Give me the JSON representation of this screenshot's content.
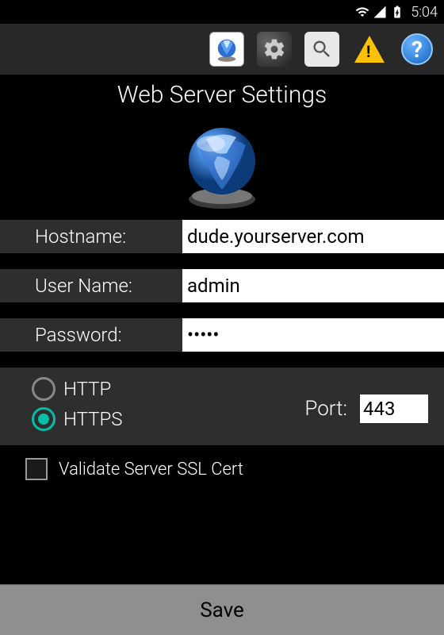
{
  "status": {
    "time": "5:04"
  },
  "title": "Web Server Settings",
  "form": {
    "hostname_label": "Hostname:",
    "hostname_value": "dude.yourserver.com",
    "username_label": "User Name:",
    "username_value": "admin",
    "password_label": "Password:",
    "password_value": "•••••"
  },
  "protocol": {
    "http_label": "HTTP",
    "https_label": "HTTPS",
    "selected": "https",
    "port_label": "Port:",
    "port_value": "443"
  },
  "ssl": {
    "validate_label": "Validate Server SSL Cert",
    "checked": false
  },
  "actions": {
    "save_label": "Save"
  },
  "toolbar": {
    "help_glyph": "?"
  }
}
